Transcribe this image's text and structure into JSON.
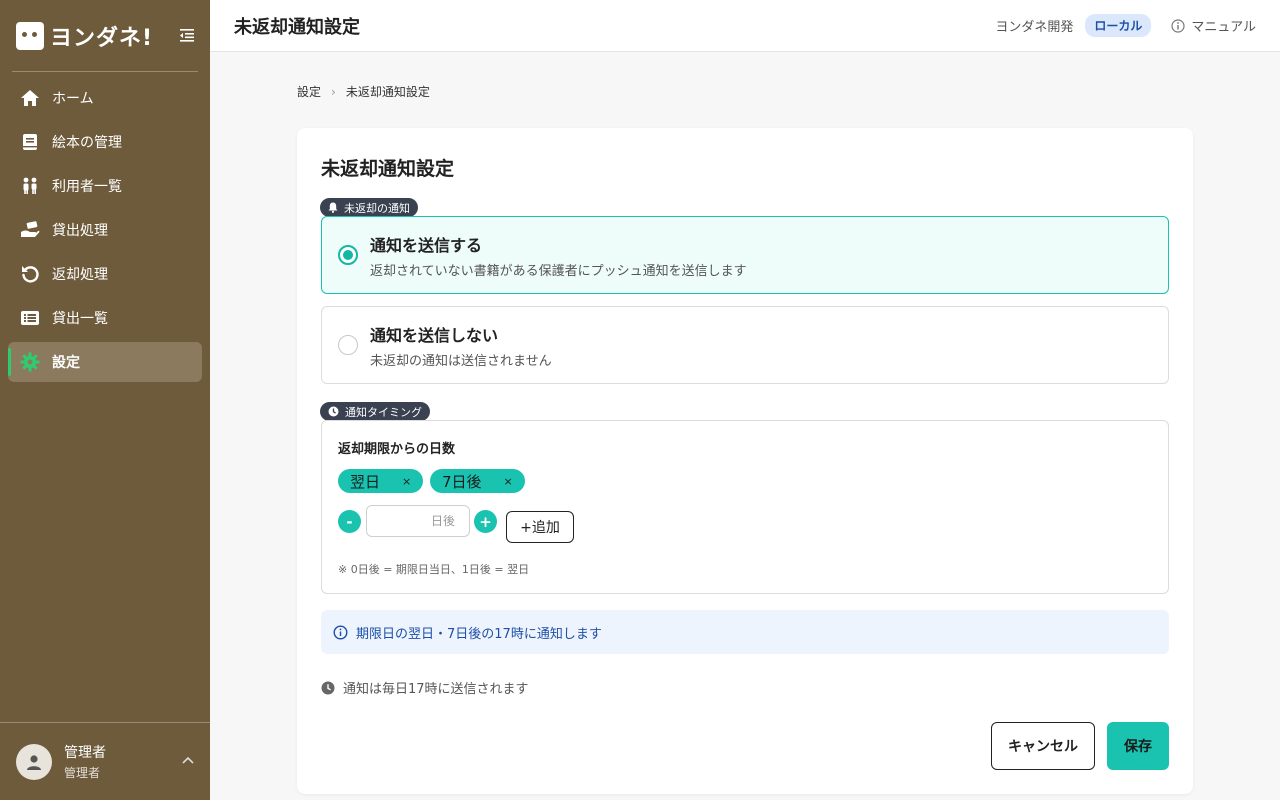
{
  "app": {
    "logo_text": "ヨンダネ!"
  },
  "sidebar": {
    "items": [
      {
        "label": "ホーム",
        "icon": "home-icon"
      },
      {
        "label": "絵本の管理",
        "icon": "book-icon"
      },
      {
        "label": "利用者一覧",
        "icon": "users-icon"
      },
      {
        "label": "貸出処理",
        "icon": "hand-lend-icon"
      },
      {
        "label": "返却処理",
        "icon": "return-arrow-icon"
      },
      {
        "label": "貸出一覧",
        "icon": "list-icon"
      },
      {
        "label": "設定",
        "icon": "gear-icon",
        "active": true
      }
    ],
    "user": {
      "name": "管理者",
      "role": "管理者"
    }
  },
  "header": {
    "title": "未返却通知設定",
    "org": "ヨンダネ開発",
    "env_badge": "ローカル",
    "manual": "マニュアル"
  },
  "breadcrumb": {
    "parent": "設定",
    "current": "未返却通知設定"
  },
  "card": {
    "title": "未返却通知設定",
    "notify_section": {
      "tag": "未返却の通知",
      "options": [
        {
          "title": "通知を送信する",
          "desc": "返却されていない書籍がある保護者にプッシュ通知を送信します",
          "selected": true
        },
        {
          "title": "通知を送信しない",
          "desc": "未返却の通知は送信されません",
          "selected": false
        }
      ]
    },
    "timing_section": {
      "tag": "通知タイミング",
      "label": "返却期限からの日数",
      "chips": [
        "翌日",
        "7日後"
      ],
      "chip_remove": "×",
      "minus": "-",
      "plus": "+",
      "input_value": "",
      "input_placeholder": "日後",
      "add_label": "+追加",
      "note": "※ 0日後 = 期限日当日、1日後 = 翌日"
    },
    "info": "期限日の翌日・7日後の17時に通知します",
    "schedule_note": "通知は毎日17時に送信されます",
    "cancel_label": "キャンセル",
    "save_label": "保存"
  },
  "colors": {
    "sidebar_bg": "#6e5b3c",
    "accent": "#19c3b0",
    "info_text": "#1d4fa8"
  }
}
